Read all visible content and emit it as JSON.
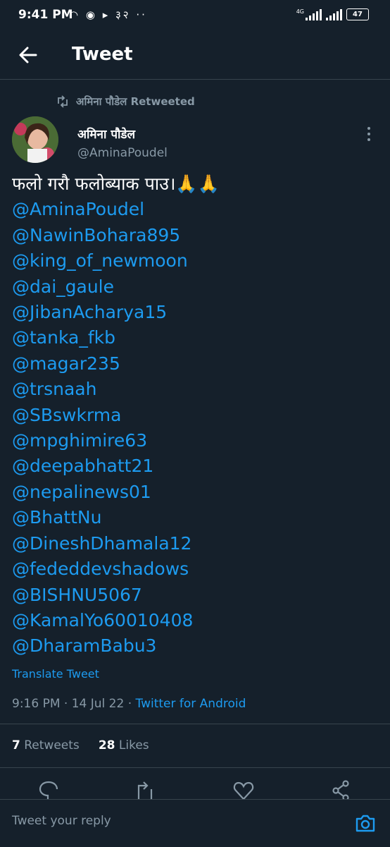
{
  "status_bar": {
    "time": "9:41 PM",
    "icons": "◠ ◉ ▸ ३२ ··",
    "network": "4G",
    "battery": "47"
  },
  "header": {
    "title": "Tweet",
    "back_icon": "back-arrow-icon"
  },
  "tweet": {
    "retweeted_by": "अमिना पौडेल Retweeted",
    "author_name": "अमिना पौडेल",
    "author_handle": "@AminaPoudel",
    "text_line": "फलो गरौ फलोब्याक पाउ।🙏🙏",
    "mentions": [
      "@AminaPoudel",
      "@NawinBohara895",
      "@king_of_newmoon",
      "@dai_gaule",
      "@JibanAcharya15",
      "@tanka_fkb",
      "@magar235",
      "@trsnaah",
      "@SBswkrma",
      "@mpghimire63",
      "@deepabhatt21",
      "@nepalinews01",
      "@BhattNu",
      "@DineshDhamala12",
      "@fededdevshadows",
      "@BISHNU5067",
      "@KamalYo60010408",
      "@DharamBabu3"
    ],
    "translate_label": "Translate Tweet",
    "timestamp": "9:16 PM · 14 Jul 22 · ",
    "client": "Twitter for Android",
    "retweets_count": "7",
    "retweets_label": "Retweets",
    "likes_count": "28",
    "likes_label": "Likes"
  },
  "reply": {
    "placeholder": "Tweet your reply"
  },
  "colors": {
    "background": "#15202b",
    "accent": "#1d9bf0",
    "muted": "#8899a6",
    "border": "#38444d"
  }
}
